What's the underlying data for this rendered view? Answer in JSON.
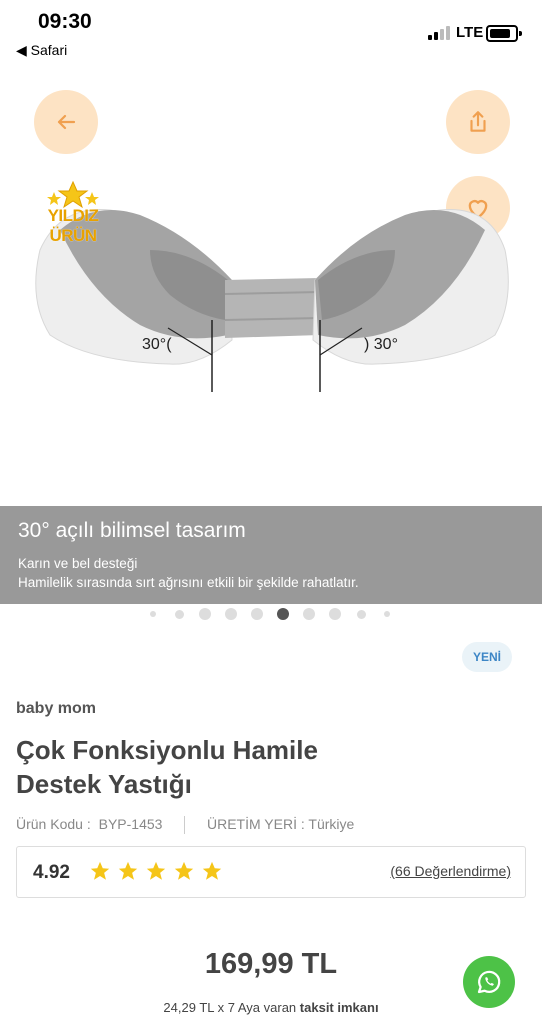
{
  "status_bar": {
    "time": "09:30",
    "back_app": "◀ Safari",
    "network": "LTE"
  },
  "hero": {
    "badge_line1": "YILDIZ",
    "badge_line2": "ÜRÜN",
    "angle_left": "30°(",
    "angle_right": ") 30°"
  },
  "caption": {
    "title": "30° açılı bilimsel tasarım",
    "line1": "Karın ve bel desteği",
    "line2": "Hamilelik sırasında sırt ağrısını etkili bir şekilde rahatlatır."
  },
  "carousel": {
    "count": 10,
    "active_index": 5
  },
  "product": {
    "new_badge": "YENİ",
    "brand": "baby mom",
    "title": "Çok Fonksiyonlu Hamile Destek Yastığı",
    "code_label": "Ürün Kodu :",
    "code_value": "BYP-1453",
    "origin_label": "ÜRETİM YERİ :",
    "origin_value": "Türkiye",
    "rating": "4.92",
    "stars": 5,
    "reviews": "(66 Değerlendirme)",
    "price": "169,99 TL",
    "installment_text": "24,29 TL x 7 Aya varan",
    "installment_bold": "taksit imkanı"
  },
  "colors": {
    "accent": "#f0a050",
    "button_bg": "#fde3c4",
    "caption_bg": "#999999",
    "star": "#f5c518",
    "whatsapp": "#4dc247"
  },
  "icons": [
    "back-arrow-icon",
    "share-icon",
    "heart-icon",
    "star-icon",
    "whatsapp-icon"
  ]
}
